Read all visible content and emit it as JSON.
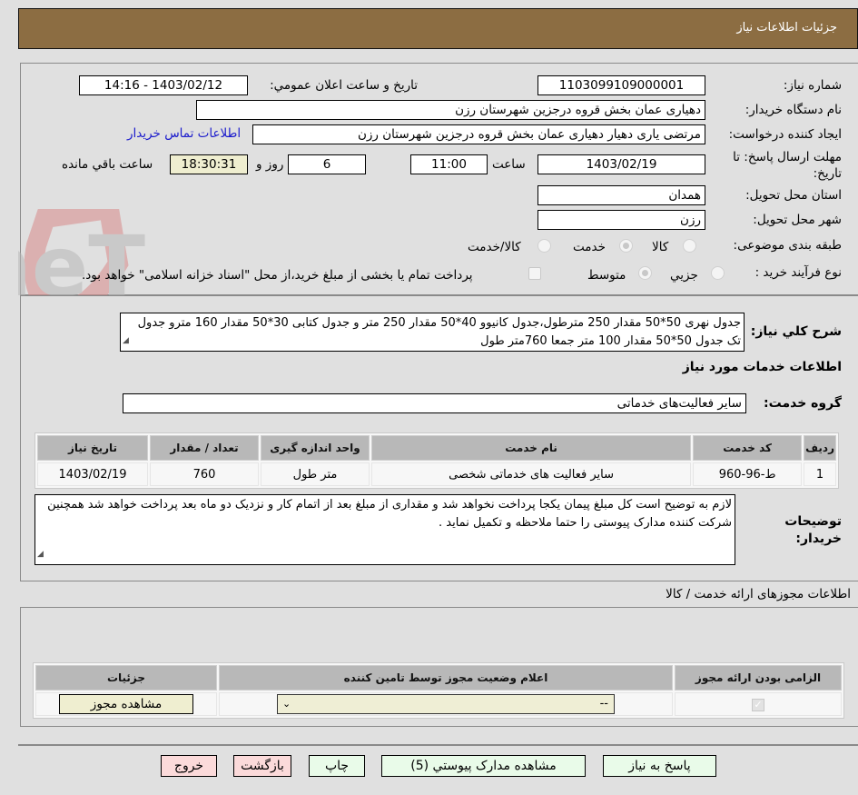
{
  "header": {
    "title": "جزئیات اطلاعات نیاز"
  },
  "form": {
    "need_number": {
      "label": "شماره نیاز:",
      "value": "1103099109000001"
    },
    "announce_datetime": {
      "label": "تاریخ و ساعت اعلان عمومي:",
      "value": "1403/02/12 - 14:16"
    },
    "buyer_org": {
      "label": "نام دستگاه خریدار:",
      "value": "دهیاری عمان بخش قروه درجزین شهرستان رزن"
    },
    "requester": {
      "label": "ایجاد کننده درخواست:",
      "value": "مرتضی یاری دهیار دهیاری عمان بخش قروه درجزین شهرستان رزن"
    },
    "buyer_contact_link": "اطلاعات تماس خریدار",
    "deadline": {
      "label_line1": "مهلت ارسال پاسخ: تا",
      "label_line2": "تاریخ:",
      "date": "1403/02/19",
      "time_label": "ساعت",
      "time": "11:00",
      "days": "6",
      "days_label": "روز و",
      "remaining": "18:30:31",
      "remaining_label": "ساعت باقي مانده"
    },
    "province": {
      "label": "استان محل تحویل:",
      "value": "همدان"
    },
    "city": {
      "label": "شهر محل تحویل:",
      "value": "رزن"
    },
    "category": {
      "label": "طبقه بندی موضوعی:",
      "options": [
        "کالا",
        "خدمت",
        "کالا/خدمت"
      ],
      "selected": "خدمت"
    },
    "purchase_type": {
      "label": "نوع فرآیند خرید :",
      "options": [
        "جزیي",
        "متوسط"
      ],
      "selected": "متوسط",
      "treasury_note": "پرداخت تمام یا بخشی از مبلغ خرید،از محل \"اسناد خزانه اسلامی\" خواهد بود."
    }
  },
  "description": {
    "label": "شرح کلي نیاز:",
    "value": "جدول نهری  50*50 مقدار 250 مترطول،جدول کانیوو 40*50 مقدار 250 متر و جدول کتابی 30*50 مقدار 160 مترو جدول تک جدول 50*50 مقدار 100 متر جمعا 760متر طول"
  },
  "services": {
    "section_title": "اطلاعات خدمات مورد نیاز",
    "group_label": "گروه خدمت:",
    "group_value": "سایر فعالیت‌های خدماتی",
    "columns": [
      "ردیف",
      "کد خدمت",
      "نام خدمت",
      "واحد اندازه گیری",
      "تعداد / مقدار",
      "تاریخ نیاز"
    ],
    "rows": [
      {
        "row": "1",
        "code": "ط-96-960",
        "name": "سایر فعالیت های خدماتی شخصی",
        "unit": "متر طول",
        "qty": "760",
        "date": "1403/02/19"
      }
    ]
  },
  "buyer_notes": {
    "label_line1": "توضیحات",
    "label_line2": "خریدار:",
    "value": "لازم به توضیح است  کل مبلغ پیمان یکجا پرداخت نخواهد شد و مقداری از مبلغ بعد از اتمام کار و نزدیک دو ماه بعد پرداخت خواهد شد همچنین شرکت کننده  مدارک پیوستی را حتما ملاحظه و تکمیل نماید ."
  },
  "permits": {
    "section_title": "اطلاعات مجوزهای ارائه خدمت / کالا",
    "columns": [
      "الزامی بودن ارائه مجوز",
      "اعلام وضعیت مجوز توسط تامین کننده",
      "جزئیات"
    ],
    "row": {
      "required_checked": true,
      "status_value": "--",
      "details_button": "مشاهده مجوز"
    }
  },
  "buttons": {
    "respond": "پاسخ به نیاز",
    "attachments": "مشاهده مدارک پیوستي (5)",
    "print": "چاپ",
    "back": "بازگشت",
    "exit": "خروج"
  },
  "watermark": {
    "text": "AriaTender.neT"
  }
}
